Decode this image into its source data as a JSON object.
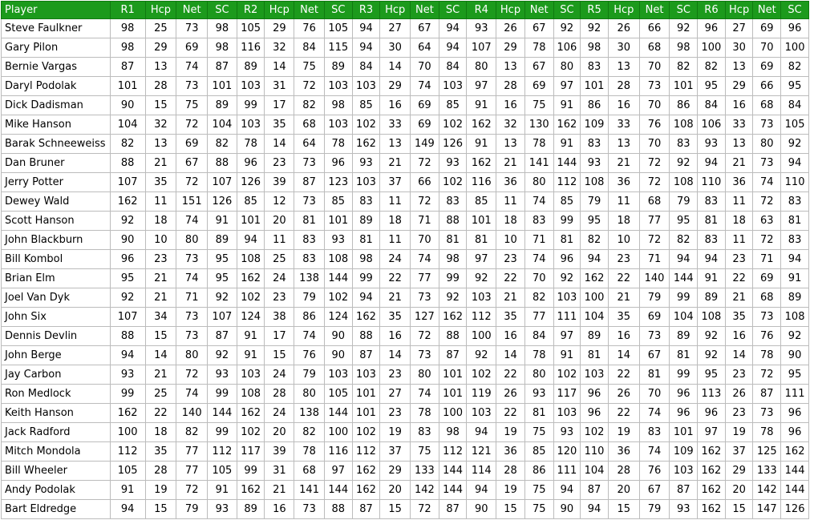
{
  "header": [
    "Player",
    "R1",
    "Hcp",
    "Net",
    "SC",
    "R2",
    "Hcp",
    "Net",
    "SC",
    "R3",
    "Hcp",
    "Net",
    "SC",
    "R4",
    "Hcp",
    "Net",
    "SC",
    "R5",
    "Hcp",
    "Net",
    "SC",
    "R6",
    "Hcp",
    "Net",
    "SC"
  ],
  "rows": [
    [
      "Steve Faulkner",
      "98",
      "25",
      "73",
      "98",
      "105",
      "29",
      "76",
      "105",
      "94",
      "27",
      "67",
      "94",
      "93",
      "26",
      "67",
      "92",
      "92",
      "26",
      "66",
      "92",
      "96",
      "27",
      "69",
      "96"
    ],
    [
      "Gary Pilon",
      "98",
      "29",
      "69",
      "98",
      "116",
      "32",
      "84",
      "115",
      "94",
      "30",
      "64",
      "94",
      "107",
      "29",
      "78",
      "106",
      "98",
      "30",
      "68",
      "98",
      "100",
      "30",
      "70",
      "100"
    ],
    [
      "Bernie Vargas",
      "87",
      "13",
      "74",
      "87",
      "89",
      "14",
      "75",
      "89",
      "84",
      "14",
      "70",
      "84",
      "80",
      "13",
      "67",
      "80",
      "83",
      "13",
      "70",
      "82",
      "82",
      "13",
      "69",
      "82"
    ],
    [
      "Daryl Podolak",
      "101",
      "28",
      "73",
      "101",
      "103",
      "31",
      "72",
      "103",
      "103",
      "29",
      "74",
      "103",
      "97",
      "28",
      "69",
      "97",
      "101",
      "28",
      "73",
      "101",
      "95",
      "29",
      "66",
      "95"
    ],
    [
      "Dick Dadisman",
      "90",
      "15",
      "75",
      "89",
      "99",
      "17",
      "82",
      "98",
      "85",
      "16",
      "69",
      "85",
      "91",
      "16",
      "75",
      "91",
      "86",
      "16",
      "70",
      "86",
      "84",
      "16",
      "68",
      "84"
    ],
    [
      "Mike Hanson",
      "104",
      "32",
      "72",
      "104",
      "103",
      "35",
      "68",
      "103",
      "102",
      "33",
      "69",
      "102",
      "162",
      "32",
      "130",
      "162",
      "109",
      "33",
      "76",
      "108",
      "106",
      "33",
      "73",
      "105"
    ],
    [
      "Barak Schneeweiss",
      "82",
      "13",
      "69",
      "82",
      "78",
      "14",
      "64",
      "78",
      "162",
      "13",
      "149",
      "126",
      "91",
      "13",
      "78",
      "91",
      "83",
      "13",
      "70",
      "83",
      "93",
      "13",
      "80",
      "92"
    ],
    [
      "Dan Bruner",
      "88",
      "21",
      "67",
      "88",
      "96",
      "23",
      "73",
      "96",
      "93",
      "21",
      "72",
      "93",
      "162",
      "21",
      "141",
      "144",
      "93",
      "21",
      "72",
      "92",
      "94",
      "21",
      "73",
      "94"
    ],
    [
      "Jerry Potter",
      "107",
      "35",
      "72",
      "107",
      "126",
      "39",
      "87",
      "123",
      "103",
      "37",
      "66",
      "102",
      "116",
      "36",
      "80",
      "112",
      "108",
      "36",
      "72",
      "108",
      "110",
      "36",
      "74",
      "110"
    ],
    [
      "Dewey Wald",
      "162",
      "11",
      "151",
      "126",
      "85",
      "12",
      "73",
      "85",
      "83",
      "11",
      "72",
      "83",
      "85",
      "11",
      "74",
      "85",
      "79",
      "11",
      "68",
      "79",
      "83",
      "11",
      "72",
      "83"
    ],
    [
      "Scott Hanson",
      "92",
      "18",
      "74",
      "91",
      "101",
      "20",
      "81",
      "101",
      "89",
      "18",
      "71",
      "88",
      "101",
      "18",
      "83",
      "99",
      "95",
      "18",
      "77",
      "95",
      "81",
      "18",
      "63",
      "81"
    ],
    [
      "John Blackburn",
      "90",
      "10",
      "80",
      "89",
      "94",
      "11",
      "83",
      "93",
      "81",
      "11",
      "70",
      "81",
      "81",
      "10",
      "71",
      "81",
      "82",
      "10",
      "72",
      "82",
      "83",
      "11",
      "72",
      "83"
    ],
    [
      "Bill Kombol",
      "96",
      "23",
      "73",
      "95",
      "108",
      "25",
      "83",
      "108",
      "98",
      "24",
      "74",
      "98",
      "97",
      "23",
      "74",
      "96",
      "94",
      "23",
      "71",
      "94",
      "94",
      "23",
      "71",
      "94"
    ],
    [
      "Brian Elm",
      "95",
      "21",
      "74",
      "95",
      "162",
      "24",
      "138",
      "144",
      "99",
      "22",
      "77",
      "99",
      "92",
      "22",
      "70",
      "92",
      "162",
      "22",
      "140",
      "144",
      "91",
      "22",
      "69",
      "91"
    ],
    [
      "Joel Van Dyk",
      "92",
      "21",
      "71",
      "92",
      "102",
      "23",
      "79",
      "102",
      "94",
      "21",
      "73",
      "92",
      "103",
      "21",
      "82",
      "103",
      "100",
      "21",
      "79",
      "99",
      "89",
      "21",
      "68",
      "89"
    ],
    [
      "John Six",
      "107",
      "34",
      "73",
      "107",
      "124",
      "38",
      "86",
      "124",
      "162",
      "35",
      "127",
      "162",
      "112",
      "35",
      "77",
      "111",
      "104",
      "35",
      "69",
      "104",
      "108",
      "35",
      "73",
      "108"
    ],
    [
      "Dennis Devlin",
      "88",
      "15",
      "73",
      "87",
      "91",
      "17",
      "74",
      "90",
      "88",
      "16",
      "72",
      "88",
      "100",
      "16",
      "84",
      "97",
      "89",
      "16",
      "73",
      "89",
      "92",
      "16",
      "76",
      "92"
    ],
    [
      "John Berge",
      "94",
      "14",
      "80",
      "92",
      "91",
      "15",
      "76",
      "90",
      "87",
      "14",
      "73",
      "87",
      "92",
      "14",
      "78",
      "91",
      "81",
      "14",
      "67",
      "81",
      "92",
      "14",
      "78",
      "90"
    ],
    [
      "Jay Carbon",
      "93",
      "21",
      "72",
      "93",
      "103",
      "24",
      "79",
      "103",
      "103",
      "23",
      "80",
      "101",
      "102",
      "22",
      "80",
      "102",
      "103",
      "22",
      "81",
      "99",
      "95",
      "23",
      "72",
      "95"
    ],
    [
      "Ron Medlock",
      "99",
      "25",
      "74",
      "99",
      "108",
      "28",
      "80",
      "105",
      "101",
      "27",
      "74",
      "101",
      "119",
      "26",
      "93",
      "117",
      "96",
      "26",
      "70",
      "96",
      "113",
      "26",
      "87",
      "111"
    ],
    [
      "Keith Hanson",
      "162",
      "22",
      "140",
      "144",
      "162",
      "24",
      "138",
      "144",
      "101",
      "23",
      "78",
      "100",
      "103",
      "22",
      "81",
      "103",
      "96",
      "22",
      "74",
      "96",
      "96",
      "23",
      "73",
      "96"
    ],
    [
      "Jack Radford",
      "100",
      "18",
      "82",
      "99",
      "102",
      "20",
      "82",
      "100",
      "102",
      "19",
      "83",
      "98",
      "94",
      "19",
      "75",
      "93",
      "102",
      "19",
      "83",
      "101",
      "97",
      "19",
      "78",
      "96"
    ],
    [
      "Mitch Mondola",
      "112",
      "35",
      "77",
      "112",
      "117",
      "39",
      "78",
      "116",
      "112",
      "37",
      "75",
      "112",
      "121",
      "36",
      "85",
      "120",
      "110",
      "36",
      "74",
      "109",
      "162",
      "37",
      "125",
      "162"
    ],
    [
      "Bill Wheeler",
      "105",
      "28",
      "77",
      "105",
      "99",
      "31",
      "68",
      "97",
      "162",
      "29",
      "133",
      "144",
      "114",
      "28",
      "86",
      "111",
      "104",
      "28",
      "76",
      "103",
      "162",
      "29",
      "133",
      "144"
    ],
    [
      "Andy Podolak",
      "91",
      "19",
      "72",
      "91",
      "162",
      "21",
      "141",
      "144",
      "162",
      "20",
      "142",
      "144",
      "94",
      "19",
      "75",
      "94",
      "87",
      "20",
      "67",
      "87",
      "162",
      "20",
      "142",
      "144"
    ],
    [
      "Bart Eldredge",
      "94",
      "15",
      "79",
      "93",
      "89",
      "16",
      "73",
      "88",
      "87",
      "15",
      "72",
      "87",
      "90",
      "15",
      "75",
      "90",
      "94",
      "15",
      "79",
      "93",
      "162",
      "15",
      "147",
      "126"
    ]
  ]
}
